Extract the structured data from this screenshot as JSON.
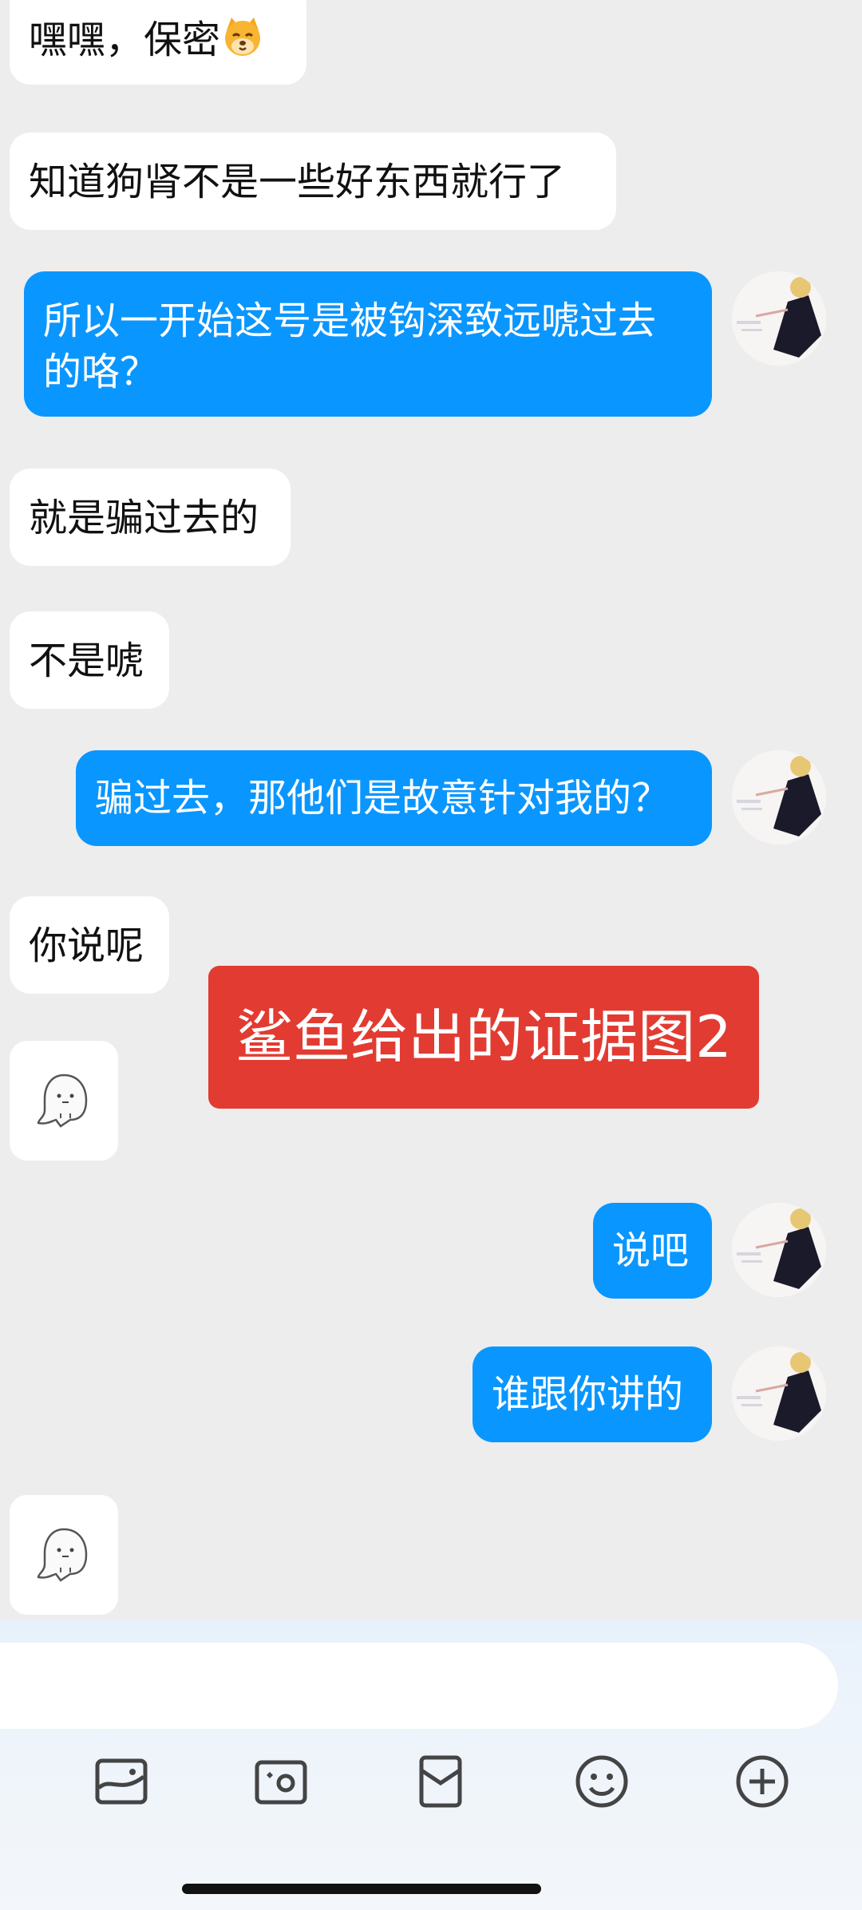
{
  "messages": [
    {
      "side": "left",
      "text": "嘿嘿，保密"
    },
    {
      "side": "left",
      "text": "知道狗肾不是一些好东西就行了"
    },
    {
      "side": "right",
      "text": "所以一开始这号是被钩深致远唬过去的咯？"
    },
    {
      "side": "left",
      "text": "就是骗过去的"
    },
    {
      "side": "left",
      "text": "不是唬"
    },
    {
      "side": "right",
      "text": "骗过去，那他们是故意针对我的？"
    },
    {
      "side": "left",
      "text": "你说呢"
    },
    {
      "side": "right",
      "text": "说吧"
    },
    {
      "side": "right",
      "text": "谁跟你讲的"
    }
  ],
  "overlay": {
    "text": "鲨鱼给出的证据图2"
  },
  "toolbar": [
    "image-icon",
    "camera-icon",
    "red-packet-icon",
    "emoji-icon",
    "add-icon"
  ],
  "colors": {
    "outgoing": "#0a96ff",
    "incoming": "#ffffff",
    "overlay": "#e23b32",
    "background": "#ededed"
  }
}
